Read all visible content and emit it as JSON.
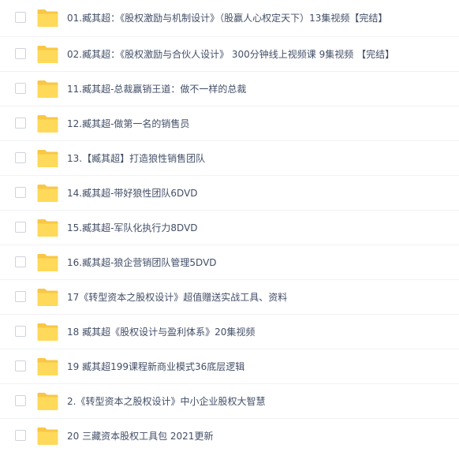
{
  "colors": {
    "folder_back": "#f8c745",
    "folder_front": "#ffd95a",
    "text": "#424e67",
    "checkbox_border": "#cfd4dc",
    "divider": "#f1f2f4"
  },
  "files": [
    {
      "name": "01.臧其超：《股权激励与机制设计》（股赢人心权定天下）13集视频【完结】",
      "icon": "folder-icon"
    },
    {
      "name": "02.臧其超：《股权激励与合伙人设计》 300分钟线上视频课 9集视频 【完结】",
      "icon": "folder-icon"
    },
    {
      "name": "11.臧其超-总裁赢销王道：做不一样的总裁",
      "icon": "folder-icon"
    },
    {
      "name": "12.臧其超-做第一名的销售员",
      "icon": "folder-icon"
    },
    {
      "name": "13.【臧其超】打造狼性销售团队",
      "icon": "folder-icon"
    },
    {
      "name": "14.臧其超-带好狼性团队6DVD",
      "icon": "folder-icon"
    },
    {
      "name": "15.臧其超-军队化执行力8DVD",
      "icon": "folder-icon"
    },
    {
      "name": "16.臧其超-狼企营销团队管理5DVD",
      "icon": "folder-icon"
    },
    {
      "name": "17《转型资本之股权设计》超值赠送实战工具、资料",
      "icon": "folder-icon"
    },
    {
      "name": "18 臧其超《股权设计与盈利体系》20集视频",
      "icon": "folder-icon"
    },
    {
      "name": "19 臧其超199课程新商业模式36底层逻辑",
      "icon": "folder-icon"
    },
    {
      "name": "2.《转型资本之股权设计》中小企业股权大智慧",
      "icon": "folder-icon"
    },
    {
      "name": "20 三藏资本股权工具包 2021更新",
      "icon": "folder-icon"
    }
  ]
}
